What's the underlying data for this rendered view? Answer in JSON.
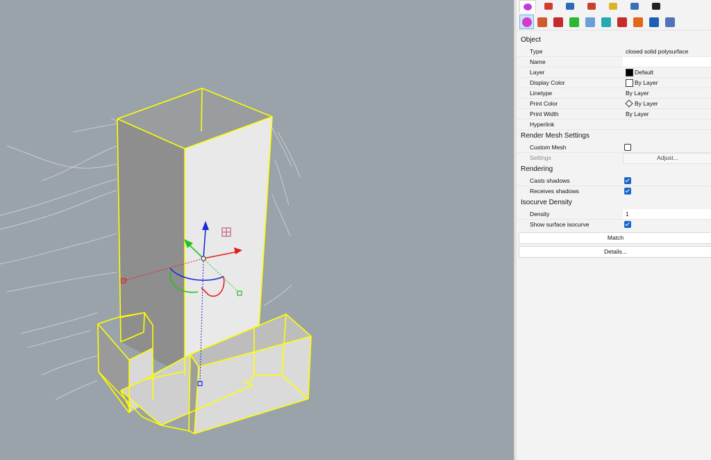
{
  "panel": {
    "tabs": [
      {
        "name": "properties-tab-icon",
        "color": "#c23bd6",
        "active": true
      },
      {
        "name": "material-tab-icon",
        "color": "#d33c2b",
        "active": false
      },
      {
        "name": "environment-tab-icon",
        "color": "#2a6ab8",
        "active": false
      },
      {
        "name": "sun-tab-icon",
        "color": "#c9412c",
        "active": false
      },
      {
        "name": "files-tab-icon",
        "color": "#e0b22c",
        "active": false
      },
      {
        "name": "display-tab-icon",
        "color": "#3a6fb0",
        "active": false
      },
      {
        "name": "monitor-tab-icon",
        "color": "#222",
        "active": false
      }
    ],
    "toolbar": [
      {
        "name": "object-properties-icon",
        "color": "#d23bcc",
        "active": true
      },
      {
        "name": "material-brush-icon",
        "color": "#cf5a2e",
        "active": false
      },
      {
        "name": "decal-icon",
        "color": "#c62a2a",
        "active": false
      },
      {
        "name": "thickness-icon",
        "color": "#29b82e",
        "active": false
      },
      {
        "name": "curve-piping-icon",
        "color": "#6b9dd8",
        "active": false
      },
      {
        "name": "displacement-icon",
        "color": "#27a9b3",
        "active": false
      },
      {
        "name": "edge-softening-icon",
        "color": "#c62a2a",
        "active": false
      },
      {
        "name": "texture-mapping-icon",
        "color": "#e06818",
        "active": false
      },
      {
        "name": "vray-icon",
        "color": "#1a5fb4",
        "active": false
      },
      {
        "name": "shutlining-icon",
        "color": "#5273b8",
        "active": false
      }
    ],
    "object_section": "Object",
    "object_rows": [
      {
        "name": "type",
        "label": "Type",
        "value": "closed solid polysurface",
        "white": false,
        "extra": "none"
      },
      {
        "name": "name",
        "label": "Name",
        "value": "",
        "white": true,
        "extra": "none"
      },
      {
        "name": "layer",
        "label": "Layer",
        "value": "Default",
        "white": false,
        "extra": "swatch-black"
      },
      {
        "name": "display-color",
        "label": "Display Color",
        "value": "By Layer",
        "white": false,
        "extra": "swatch-white"
      },
      {
        "name": "linetype",
        "label": "Linetype",
        "value": "By Layer",
        "white": false,
        "extra": "none"
      },
      {
        "name": "print-color",
        "label": "Print Color",
        "value": "By Layer",
        "white": false,
        "extra": "diamond"
      },
      {
        "name": "print-width",
        "label": "Print Width",
        "value": "By Layer",
        "white": false,
        "extra": "none"
      },
      {
        "name": "hyperlink",
        "label": "Hyperlink",
        "value": "",
        "white": false,
        "extra": "none"
      }
    ],
    "render_mesh_section": "Render Mesh Settings",
    "custom_mesh_label": "Custom Mesh",
    "custom_mesh_checked": false,
    "settings_label": "Settings",
    "adjust_label": "Adjust...",
    "rendering_section": "Rendering",
    "casts_shadows_label": "Casts shadows",
    "casts_shadows_checked": true,
    "receives_shadows_label": "Receives shadows",
    "receives_shadows_checked": true,
    "isocurve_section": "Isocurve Density",
    "density_label": "Density",
    "density_value": "1",
    "show_isocurve_label": "Show surface isocurve",
    "show_isocurve_checked": true,
    "match_label": "Match",
    "details_label": "Details..."
  },
  "viewport": {
    "background": "#9aa2aa",
    "selection_color": "#ffff00",
    "gumball_x_color": "#e02020",
    "gumball_y_color": "#22c022",
    "gumball_z_color": "#1a2ad8"
  }
}
